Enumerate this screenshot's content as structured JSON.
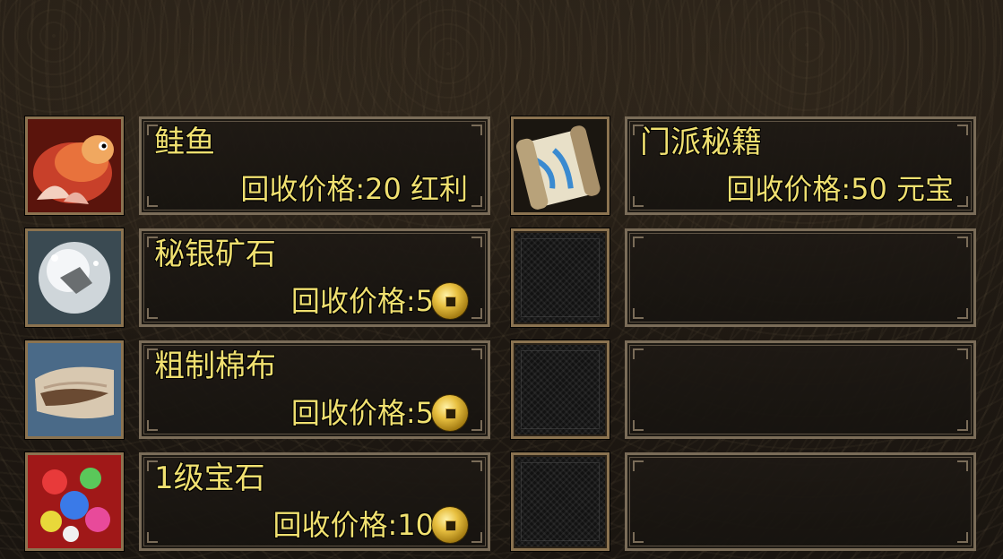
{
  "header": {
    "faint_title": ""
  },
  "slots": [
    {
      "name": "鲑鱼",
      "price": "回收价格:20 红利",
      "icon": "salmon-icon",
      "currency": "text"
    },
    {
      "name": "门派秘籍",
      "price": "回收价格:50 元宝",
      "icon": "scroll-icon",
      "currency": "text"
    },
    {
      "name": "秘银矿石",
      "price": "回收价格:5",
      "icon": "silver-ore-icon",
      "currency": "coin"
    },
    {
      "name": "",
      "price": "",
      "icon": "empty-slot",
      "currency": "none"
    },
    {
      "name": "粗制棉布",
      "price": "回收价格:5",
      "icon": "cotton-cloth-icon",
      "currency": "coin"
    },
    {
      "name": "",
      "price": "",
      "icon": "empty-slot",
      "currency": "none"
    },
    {
      "name": "1级宝石",
      "price": "回收价格:10",
      "icon": "gems-icon",
      "currency": "coin"
    },
    {
      "name": "",
      "price": "",
      "icon": "empty-slot",
      "currency": "none"
    }
  ],
  "colors": {
    "text": "#f0e070",
    "frame": "#8b7350",
    "panel": "#1c1711"
  }
}
